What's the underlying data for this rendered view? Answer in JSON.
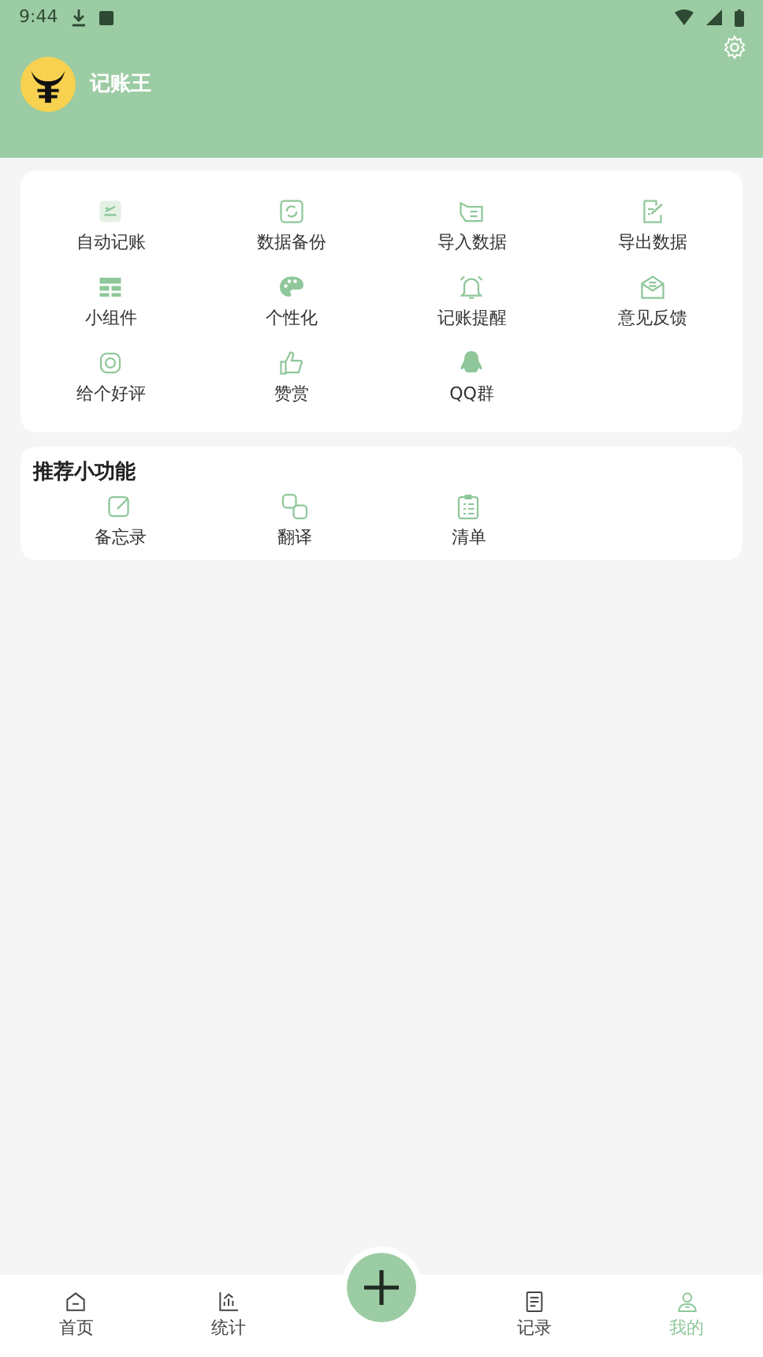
{
  "status_bar": {
    "time": "9:44"
  },
  "header": {
    "app_name": "记账王"
  },
  "tools": [
    {
      "label": "自动记账"
    },
    {
      "label": "数据备份"
    },
    {
      "label": "导入数据"
    },
    {
      "label": "导出数据"
    },
    {
      "label": "小组件"
    },
    {
      "label": "个性化"
    },
    {
      "label": "记账提醒"
    },
    {
      "label": "意见反馈"
    },
    {
      "label": "给个好评"
    },
    {
      "label": "赞赏"
    },
    {
      "label": "QQ群"
    }
  ],
  "recommended": {
    "title": "推荐小功能",
    "items": [
      {
        "label": "备忘录"
      },
      {
        "label": "翻译"
      },
      {
        "label": "清单"
      }
    ]
  },
  "bottom_nav": [
    {
      "kind": "tab",
      "label": "首页",
      "selected": false
    },
    {
      "kind": "tab",
      "label": "统计",
      "selected": false
    },
    {
      "kind": "add"
    },
    {
      "kind": "tab",
      "label": "记录",
      "selected": false
    },
    {
      "kind": "tab",
      "label": "我的",
      "selected": true
    }
  ]
}
